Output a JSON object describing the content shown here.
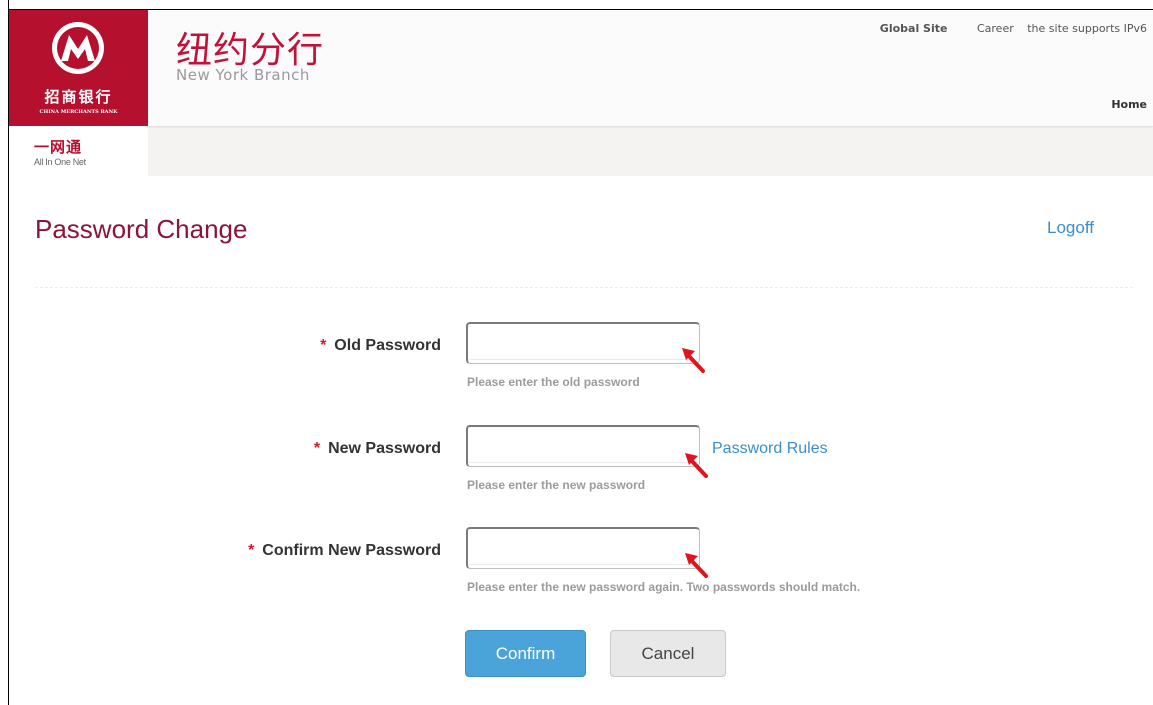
{
  "header": {
    "logo_cn": "招商银行",
    "logo_en": "CHINA MERCHANTS BANK",
    "branch_cn": "纽约分行",
    "branch_en": "New York Branch",
    "links": {
      "global_site": "Global Site",
      "career": "Career",
      "ipv6": "the site supports IPv6",
      "home": "Home"
    }
  },
  "subnav": {
    "product_cn": "一网通",
    "product_en": "All In One Net"
  },
  "page": {
    "title": "Password Change",
    "logoff": "Logoff"
  },
  "form": {
    "required_mark": "*",
    "fields": [
      {
        "label": "Old Password",
        "value": "",
        "hint": "Please enter the old password"
      },
      {
        "label": "New Password",
        "value": "",
        "hint": "Please enter the new password"
      },
      {
        "label": "Confirm New Password",
        "value": "",
        "hint": "Please enter the new password again. Two passwords should match."
      }
    ],
    "password_rules": "Password Rules",
    "confirm_label": "Confirm",
    "cancel_label": "Cancel"
  },
  "colors": {
    "brand_red": "#b5112f",
    "title_maroon": "#8a1538",
    "link_blue": "#3a8ecf",
    "confirm_blue": "#4aa3d9",
    "annotation_arrow": "#e0141e"
  }
}
